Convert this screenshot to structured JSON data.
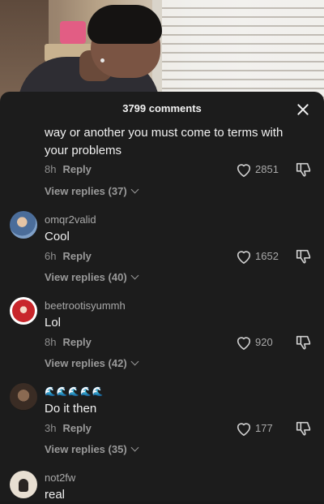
{
  "header": {
    "title": "3799 comments",
    "close_icon": "close-icon"
  },
  "comments": [
    {
      "text": "way or another you must come to terms with your problems",
      "time": "8h",
      "reply_label": "Reply",
      "likes": "2851",
      "view_replies": "View replies (37)"
    },
    {
      "username": "omqr2valid",
      "text": "Cool",
      "time": "6h",
      "reply_label": "Reply",
      "likes": "1652",
      "view_replies": "View replies (40)"
    },
    {
      "username": "beetrootisyummh",
      "text": "Lol",
      "time": "8h",
      "reply_label": "Reply",
      "likes": "920",
      "view_replies": "View replies (42)"
    },
    {
      "username": "🌊🌊🌊🌊🌊",
      "text": "Do it then",
      "time": "3h",
      "reply_label": "Reply",
      "likes": "177",
      "view_replies": "View replies (35)"
    },
    {
      "username": "not2fw",
      "text": "real"
    }
  ],
  "colors": {
    "panel_bg": "#1c1c1c",
    "text_primary": "#f1f1f1",
    "text_secondary": "#a9a9a9"
  }
}
